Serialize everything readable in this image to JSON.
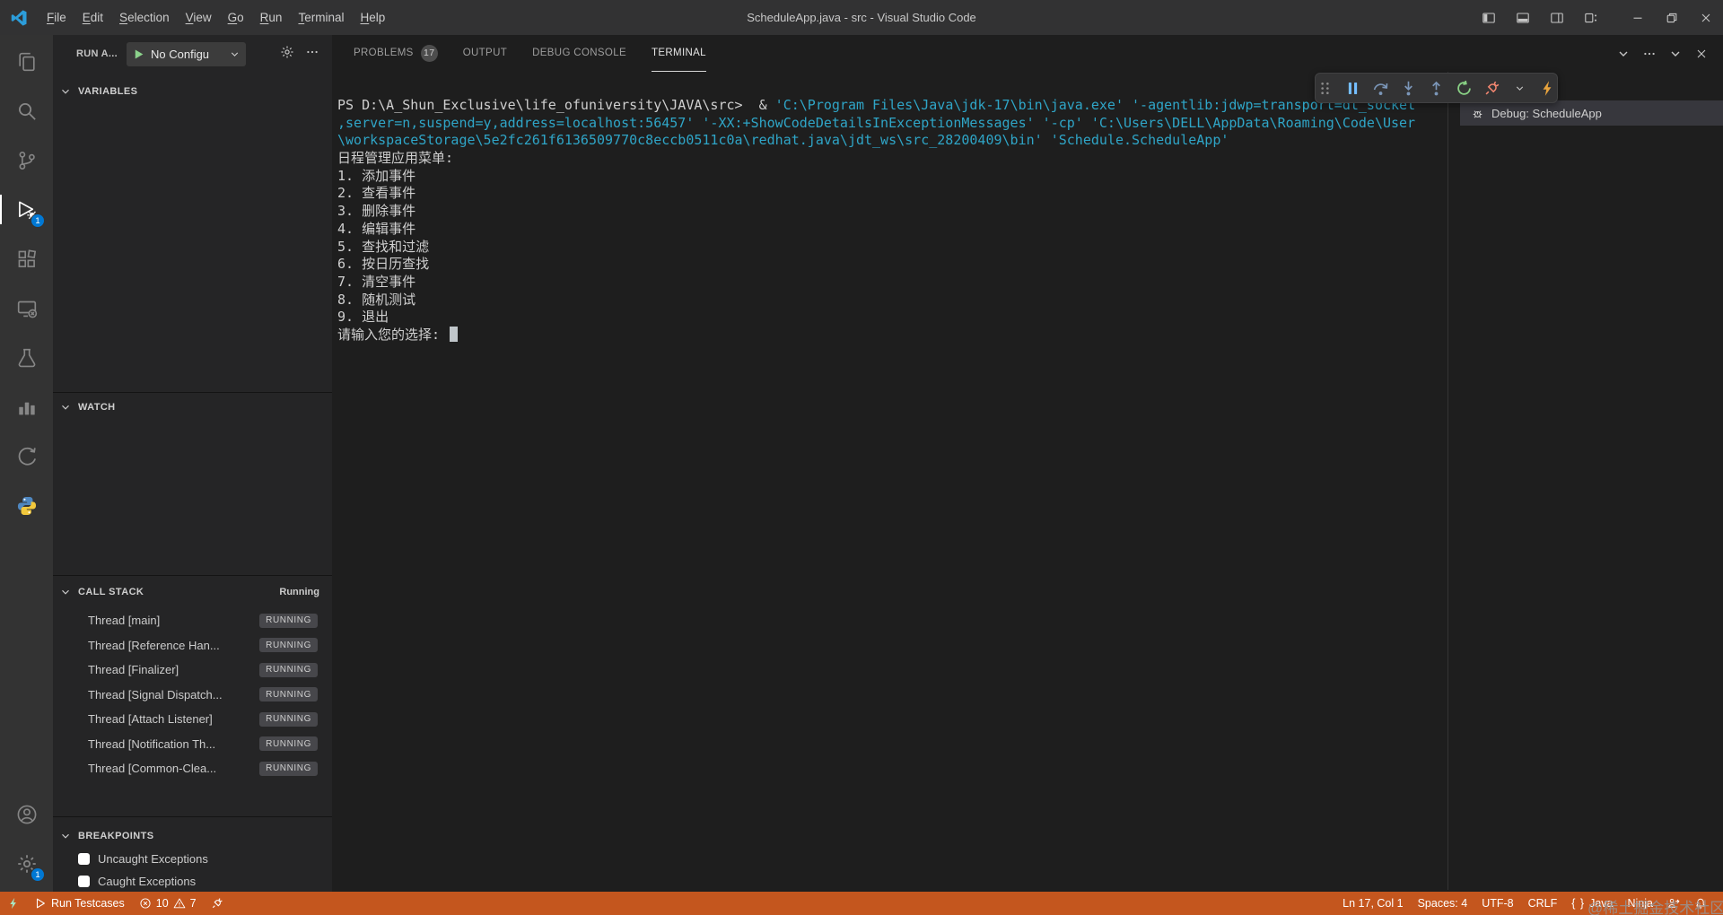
{
  "title_bar": {
    "app_title": "ScheduleApp.java - src - Visual Studio Code",
    "menus": [
      "File",
      "Edit",
      "Selection",
      "View",
      "Go",
      "Run",
      "Terminal",
      "Help"
    ],
    "layout_controls": [
      "layout-sidebar-left",
      "layout-panel",
      "layout-sidebar-right",
      "layout-customize"
    ],
    "window_controls": [
      "minimize",
      "restore",
      "close"
    ]
  },
  "activity_bar": {
    "top": [
      {
        "name": "explorer",
        "icon": "files"
      },
      {
        "name": "search",
        "icon": "search"
      },
      {
        "name": "source-control",
        "icon": "source-control"
      },
      {
        "name": "run-and-debug",
        "icon": "debug",
        "active": true,
        "badge": "1"
      },
      {
        "name": "extensions",
        "icon": "extensions"
      },
      {
        "name": "remote-explorer",
        "icon": "remote"
      },
      {
        "name": "testing",
        "icon": "beaker"
      },
      {
        "name": "chart-extension",
        "icon": "bar-chart"
      },
      {
        "name": "leetcode-extension",
        "icon": "curve-arrow"
      },
      {
        "name": "python-extension",
        "icon": "python"
      }
    ],
    "bottom": [
      {
        "name": "accounts",
        "icon": "account"
      },
      {
        "name": "settings",
        "icon": "gear",
        "badge": "1"
      }
    ]
  },
  "sidebar": {
    "view_title": "RUN A...",
    "run_config": {
      "label": "No Configu"
    },
    "header_actions": [
      "gear",
      "ellipsis"
    ],
    "variables": {
      "label": "VARIABLES"
    },
    "watch": {
      "label": "WATCH"
    },
    "call_stack": {
      "label": "CALL STACK",
      "status": "Running",
      "threads": [
        {
          "name": "Thread [main]",
          "state": "RUNNING"
        },
        {
          "name": "Thread [Reference Han...",
          "state": "RUNNING"
        },
        {
          "name": "Thread [Finalizer]",
          "state": "RUNNING"
        },
        {
          "name": "Thread [Signal Dispatch...",
          "state": "RUNNING"
        },
        {
          "name": "Thread [Attach Listener]",
          "state": "RUNNING"
        },
        {
          "name": "Thread [Notification Th...",
          "state": "RUNNING"
        },
        {
          "name": "Thread [Common-Clea...",
          "state": "RUNNING"
        }
      ]
    },
    "breakpoints": {
      "label": "BREAKPOINTS",
      "items": [
        {
          "label": "Uncaught Exceptions",
          "checked": false
        },
        {
          "label": "Caught Exceptions",
          "checked": false
        }
      ]
    }
  },
  "panel": {
    "tabs": [
      {
        "label": "PROBLEMS",
        "badge": "17"
      },
      {
        "label": "OUTPUT"
      },
      {
        "label": "DEBUG CONSOLE"
      },
      {
        "label": "TERMINAL",
        "active": true
      }
    ],
    "actions": [
      "panel-layout",
      "chevron-down",
      "ellipsis",
      "chevron-down",
      "close"
    ],
    "debug_toolbar": [
      {
        "name": "drag-handle",
        "icon": "gripper",
        "cls": "c-grip"
      },
      {
        "name": "pause-button",
        "icon": "pause",
        "cls": "c-pause"
      },
      {
        "name": "step-over-button",
        "icon": "step-over",
        "cls": "c-step"
      },
      {
        "name": "step-into-button",
        "icon": "step-into",
        "cls": "c-step"
      },
      {
        "name": "step-out-button",
        "icon": "step-out",
        "cls": "c-step"
      },
      {
        "name": "restart-button",
        "icon": "restart",
        "cls": "c-restart"
      },
      {
        "name": "disconnect-button",
        "icon": "plug",
        "cls": "c-disc"
      },
      {
        "name": "disconnect-chevron",
        "icon": "chevron-down",
        "cls": "c-chev small"
      },
      {
        "name": "hot-code-replace-button",
        "icon": "lightning",
        "cls": "c-bolt"
      }
    ],
    "terminal_list": {
      "label": "Debug: ScheduleApp"
    },
    "terminal_lines": [
      {
        "segments": [
          {
            "text": "PS D:\\A_Shun_Exclusive\\life_ofuniversity\\JAVA\\src>  & ",
            "color": "white"
          },
          {
            "text": "'C:\\Program Files\\Java\\jdk-17\\bin\\java.exe' '-agentlib:jdwp=transport=dt_socket",
            "color": "cyan"
          }
        ]
      },
      {
        "segments": [
          {
            "text": ",server=n,suspend=y,address=localhost:56457' '-XX:+ShowCodeDetailsInExceptionMessages' '-cp' 'C:\\Users\\DELL\\AppData\\Roaming\\Code\\User",
            "color": "cyan"
          }
        ]
      },
      {
        "segments": [
          {
            "text": "\\workspaceStorage\\5e2fc261f6136509770c8eccb0511c0a\\redhat.java\\jdt_ws\\src_28200409\\bin' 'Schedule.ScheduleApp'",
            "color": "cyan"
          }
        ]
      },
      {
        "segments": [
          {
            "text": "日程管理应用菜单:",
            "color": "white"
          }
        ]
      },
      {
        "segments": [
          {
            "text": "1. 添加事件",
            "color": "white"
          }
        ]
      },
      {
        "segments": [
          {
            "text": "2. 查看事件",
            "color": "white"
          }
        ]
      },
      {
        "segments": [
          {
            "text": "3. 删除事件",
            "color": "white"
          }
        ]
      },
      {
        "segments": [
          {
            "text": "4. 编辑事件",
            "color": "white"
          }
        ]
      },
      {
        "segments": [
          {
            "text": "5. 查找和过滤",
            "color": "white"
          }
        ]
      },
      {
        "segments": [
          {
            "text": "6. 按日历查找",
            "color": "white"
          }
        ]
      },
      {
        "segments": [
          {
            "text": "7. 清空事件",
            "color": "white"
          }
        ]
      },
      {
        "segments": [
          {
            "text": "8. 随机测试",
            "color": "white"
          }
        ]
      },
      {
        "segments": [
          {
            "text": "9. 退出",
            "color": "white"
          }
        ]
      },
      {
        "segments": [
          {
            "text": "请输入您的选择: ",
            "color": "white"
          }
        ],
        "cursor": true
      }
    ]
  },
  "status_bar": {
    "left": [
      {
        "name": "remote-indicator",
        "icon": "lightning",
        "cls": "remote-ic"
      },
      {
        "name": "run-testcases-button",
        "icon": "play-outline",
        "label": "Run Testcases"
      },
      {
        "name": "problems-summary",
        "errors": "10",
        "warnings": "7"
      },
      {
        "name": "debug-disconnect-button",
        "icon": "plug"
      }
    ],
    "right": [
      {
        "name": "cursor-position",
        "label": "Ln 17, Col 1"
      },
      {
        "name": "indentation",
        "label": "Spaces: 4"
      },
      {
        "name": "encoding",
        "label": "UTF-8"
      },
      {
        "name": "eol-sequence",
        "label": "CRLF"
      },
      {
        "name": "language-mode",
        "icon": "braces",
        "label": "Java"
      },
      {
        "name": "ninja-extension",
        "label": "Ninja"
      },
      {
        "name": "feedback",
        "icon": "person-arrow"
      },
      {
        "name": "notifications-bell",
        "icon": "bell"
      }
    ]
  },
  "watermark": {
    "text": "@稀土掘金技术社区"
  },
  "colors": {
    "accent_blue": "#0078d4",
    "debug_orange": "#c4561e",
    "terminal_cyan": "#2fa5c7",
    "running_green": "#89d185"
  }
}
